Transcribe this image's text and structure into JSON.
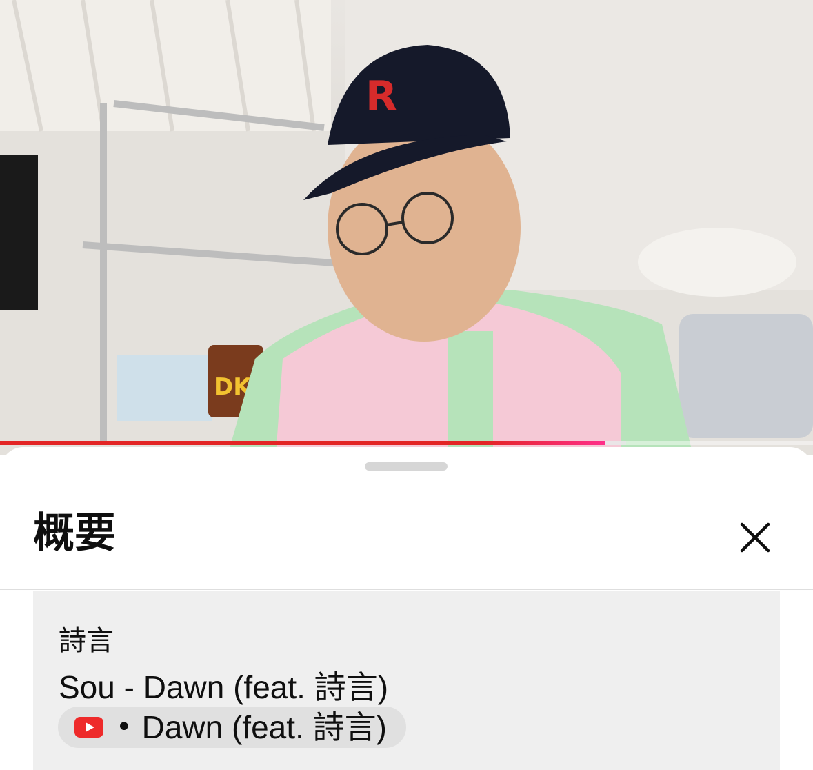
{
  "player": {
    "progress_percent": 74.5,
    "buffered_percent": 77,
    "progress_color": "#e32525"
  },
  "sheet": {
    "title": "概要",
    "close_icon": "close-icon"
  },
  "description": {
    "artist": "詩言",
    "track_title": "Sou - Dawn (feat. 詩言)",
    "chip": {
      "icon": "youtube-icon",
      "separator": "•",
      "label": "Dawn (feat. 詩言)"
    }
  }
}
